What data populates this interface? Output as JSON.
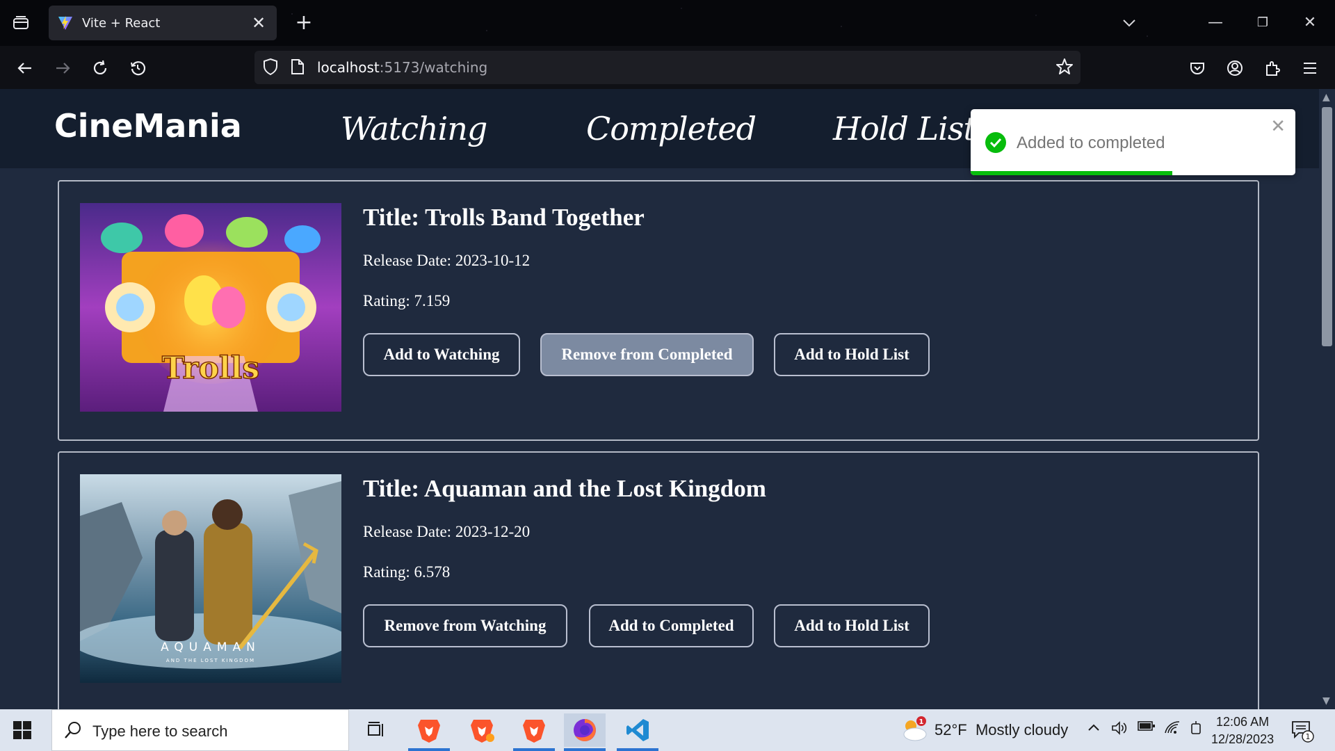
{
  "browser": {
    "tab_title": "Vite + React",
    "tab_close": "✕",
    "new_tab": "+",
    "url_host": "localhost",
    "url_path": ":5173/watching",
    "window_controls": [
      "—",
      "❐",
      "✕"
    ]
  },
  "site": {
    "brand": "CineMania",
    "nav": [
      "Watching",
      "Completed",
      "Hold List"
    ]
  },
  "toast": {
    "message": "Added to completed",
    "close": "✕",
    "progress_fraction": 0.62,
    "accent": "#07bc0c"
  },
  "movies": [
    {
      "title": "Title: Trolls Band Together",
      "release": "Release Date: 2023-10-12",
      "rating": "Rating: 7.159",
      "poster_text": "Trolls",
      "buttons": [
        "Add to Watching",
        "Remove from Completed",
        "Add to Hold List"
      ]
    },
    {
      "title": "Title: Aquaman and the Lost Kingdom",
      "release": "Release Date: 2023-12-20",
      "rating": "Rating: 6.578",
      "poster_text": "AQUAMAN",
      "poster_subtext": "AND THE LOST KINGDOM",
      "buttons": [
        "Remove from Watching",
        "Add to Completed",
        "Add to Hold List"
      ]
    }
  ],
  "taskbar": {
    "search_placeholder": "Type here to search",
    "weather_temp": "52°F",
    "weather_desc": "Mostly cloudy",
    "weather_badge": "1",
    "time": "12:06 AM",
    "date": "12/28/2023",
    "notification_count": "1"
  },
  "colors": {
    "page_bg": "#1f2a3e",
    "header_bg": "#141e2e",
    "active_button": "#7c8aa1"
  }
}
